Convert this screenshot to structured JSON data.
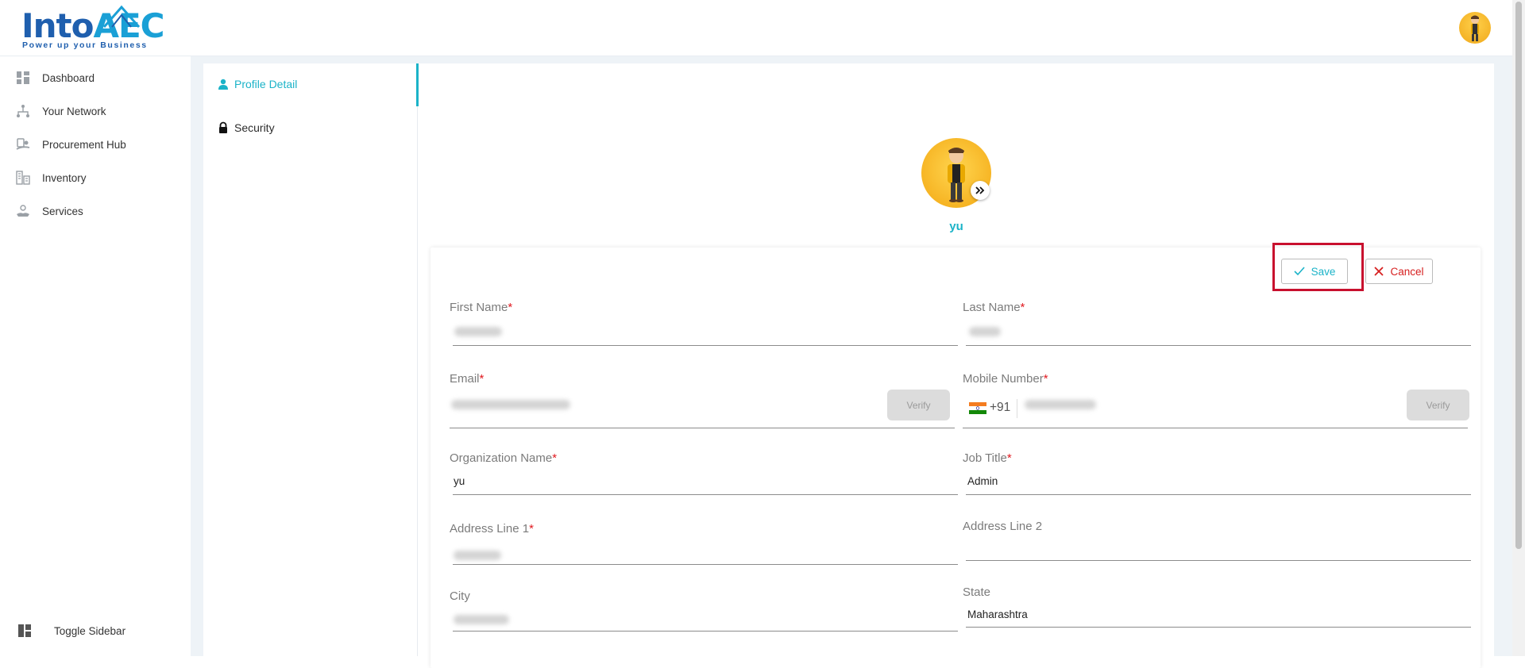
{
  "brand": {
    "name_part1": "Into",
    "name_part2": "AEC",
    "tagline": "Power up your Business"
  },
  "sidebar": {
    "items": [
      {
        "label": "Dashboard",
        "icon": "dashboard-icon"
      },
      {
        "label": "Your Network",
        "icon": "network-icon"
      },
      {
        "label": "Procurement Hub",
        "icon": "procurement-icon"
      },
      {
        "label": "Inventory",
        "icon": "inventory-icon"
      },
      {
        "label": "Services",
        "icon": "services-icon"
      }
    ],
    "toggle_label": "Toggle Sidebar"
  },
  "settings_tabs": [
    {
      "label": "Profile Detail",
      "active": true,
      "icon": "user-icon"
    },
    {
      "label": "Security",
      "active": false,
      "icon": "lock-icon"
    }
  ],
  "profile": {
    "name": "yu"
  },
  "actions": {
    "save_label": "Save",
    "cancel_label": "Cancel"
  },
  "form": {
    "first_name": {
      "label": "First Name",
      "required_mark": "*"
    },
    "last_name": {
      "label": "Last Name",
      "required_mark": "*"
    },
    "email": {
      "label": "Email",
      "required_mark": "*",
      "verify_label": "Verify"
    },
    "mobile": {
      "label": "Mobile Number",
      "required_mark": "*",
      "country_code": "+91",
      "verify_label": "Verify"
    },
    "organization": {
      "label": "Organization Name",
      "required_mark": "*",
      "value": "yu"
    },
    "job_title": {
      "label": "Job Title",
      "required_mark": "*",
      "value": "Admin"
    },
    "address1": {
      "label": "Address Line 1",
      "required_mark": "*"
    },
    "address2": {
      "label": "Address Line 2",
      "value": ""
    },
    "city": {
      "label": "City"
    },
    "state": {
      "label": "State",
      "value": "Maharashtra"
    }
  },
  "colors": {
    "accent": "#1bb3c8",
    "danger": "#d61f1f",
    "highlight": "#c8102e",
    "brand": "#1f5fae"
  }
}
